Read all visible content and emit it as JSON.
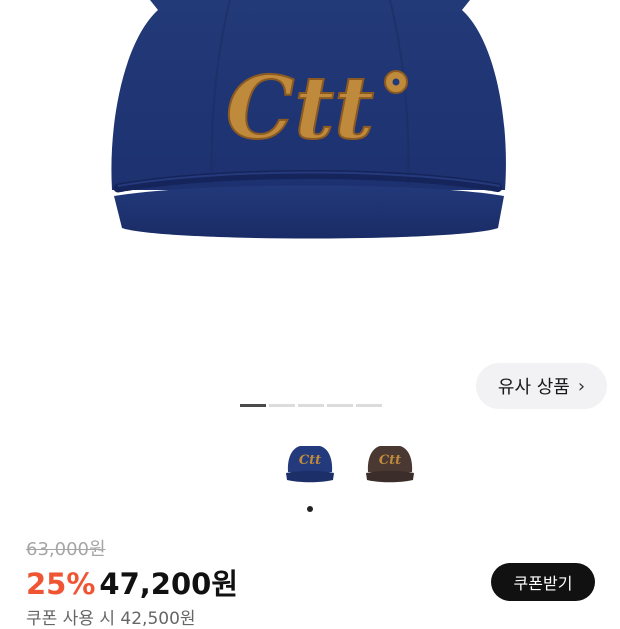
{
  "gallery": {
    "logo_text": "Ctt",
    "similar_button_label": "유사 상품",
    "similar_button_icon": "chevron-right-icon",
    "page_count": 5,
    "active_page": 1,
    "thumbnails": [
      {
        "name": "navy",
        "color": "#233b7c",
        "logo_color": "#c08a3c"
      },
      {
        "name": "brown",
        "color": "#4a3933",
        "logo_color": "#c08a3c"
      }
    ]
  },
  "pricing": {
    "original_price": "63,000원",
    "discount_rate": "25%",
    "sale_price": "47,200원",
    "coupon_button_label": "쿠폰받기",
    "coupon_note": "쿠폰 사용 시 42,500원"
  },
  "colors": {
    "discount": "#ef5533",
    "cap_navy": "#233b7c",
    "logo_felt": "#c08a3c"
  }
}
